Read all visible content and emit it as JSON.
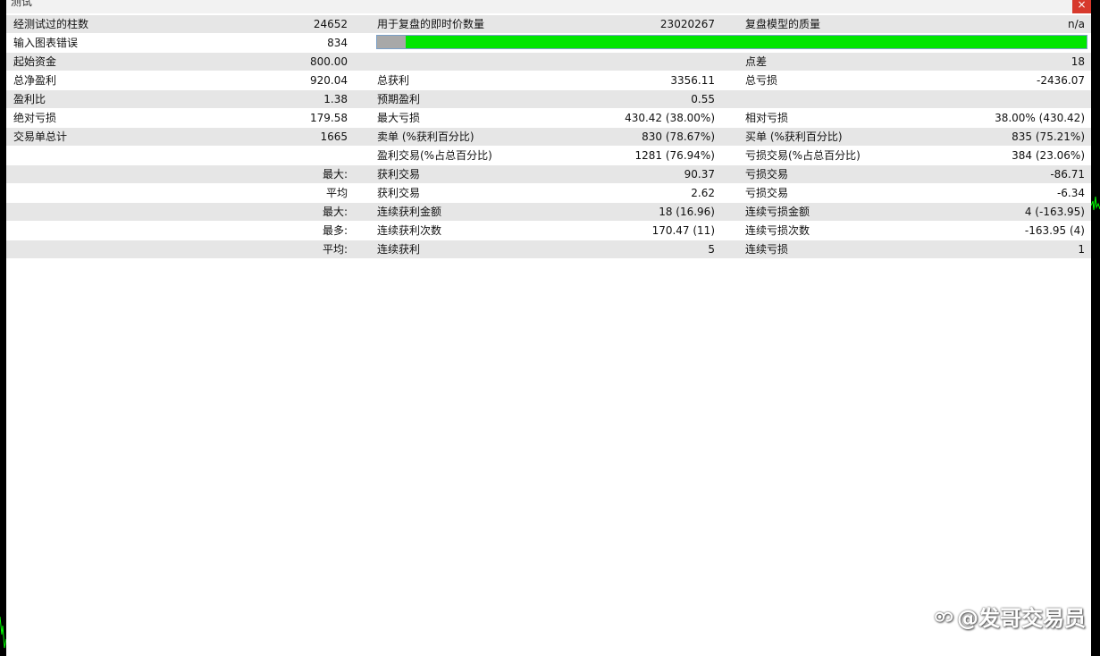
{
  "window": {
    "title": "测试",
    "close_glyph": "×"
  },
  "report": {
    "rows": [
      {
        "l1": "经测试过的柱数",
        "v1": "24652",
        "l2": "用于复盘的即时价数量",
        "v2": "23020267",
        "l3": "复盘模型的质量",
        "v3": "n/a"
      },
      {
        "l1": "输入图表错误",
        "v1": "834"
      },
      {
        "l1": "起始资金",
        "v1": "800.00",
        "l2": "",
        "v2": "",
        "l3": "点差",
        "v3": "18"
      },
      {
        "l1": "总净盈利",
        "v1": "920.04",
        "l2": "总获利",
        "v2": "3356.11",
        "l3": "总亏损",
        "v3": "-2436.07"
      },
      {
        "l1": "盈利比",
        "v1": "1.38",
        "l2": "预期盈利",
        "v2": "0.55",
        "l3": "",
        "v3": ""
      },
      {
        "l1": "绝对亏损",
        "v1": "179.58",
        "l2": "最大亏损",
        "v2": "430.42 (38.00%)",
        "l3": "相对亏损",
        "v3": "38.00% (430.42)"
      },
      {
        "l1": "交易单总计",
        "v1": "1665",
        "l2": "卖单 (%获利百分比)",
        "v2": "830 (78.67%)",
        "l3": "买单 (%获利百分比)",
        "v3": "835 (75.21%)"
      },
      {
        "l1": "",
        "v1": "",
        "l2": "盈利交易(%占总百分比)",
        "v2": "1281 (76.94%)",
        "l3": "亏损交易(%占总百分比)",
        "v3": "384 (23.06%)"
      },
      {
        "l1": "",
        "v1": "最大:",
        "l2": "获利交易",
        "v2": "90.37",
        "l3": "亏损交易",
        "v3": "-86.71"
      },
      {
        "l1": "",
        "v1": "平均",
        "l2": "获利交易",
        "v2": "2.62",
        "l3": "亏损交易",
        "v3": "-6.34"
      },
      {
        "l1": "",
        "v1": "最大:",
        "l2": "连续获利金额",
        "v2": "18 (16.96)",
        "l3": "连续亏损金额",
        "v3": "4 (-163.95)"
      },
      {
        "l1": "",
        "v1": "最多:",
        "l2": "连续获利次数",
        "v2": "170.47 (11)",
        "l3": "连续亏损次数",
        "v3": "-163.95 (4)"
      },
      {
        "l1": "",
        "v1": "平均:",
        "l2": "连续获利",
        "v2": "5",
        "l3": "连续亏损",
        "v3": "1"
      }
    ],
    "quality_bar": {
      "gray_fraction": 0.04,
      "fill_color": "#00e600",
      "gray_color": "#a8a8a8"
    }
  },
  "watermark": {
    "text": "@发哥交易员",
    "icon": "toutiao-logo-icon"
  },
  "colors": {
    "row_shade": "#e6e6e6",
    "chart_line": "#00ff00"
  }
}
